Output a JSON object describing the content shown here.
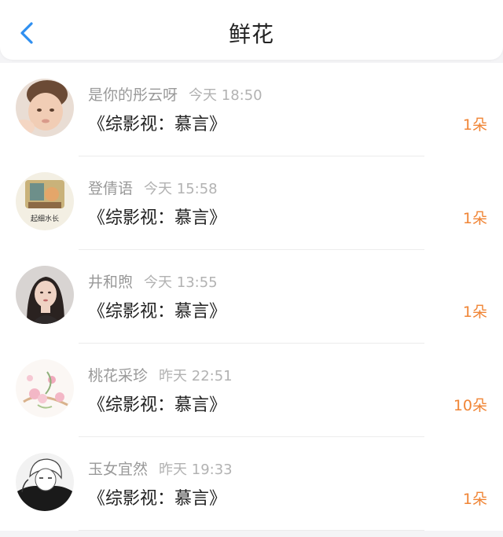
{
  "header": {
    "title": "鲜花",
    "back_icon": "chevron-left-icon",
    "accent": "#2f8ff0"
  },
  "colors": {
    "count": "#f08536",
    "name": "#999999",
    "book": "#222222"
  },
  "gifts": [
    {
      "user": "是你的彤云呀",
      "time": "今天 18:50",
      "book": "《综影视：慕言》",
      "count": "1朵",
      "avatar": "baby-photo-avatar"
    },
    {
      "user": "登倩语",
      "time": "今天 15:58",
      "book": "《综影视：慕言》",
      "count": "1朵",
      "avatar": "illustration-avatar",
      "avatar_text": "起细水长"
    },
    {
      "user": "井和煦",
      "time": "今天 13:55",
      "book": "《综影视：慕言》",
      "count": "1朵",
      "avatar": "woman-portrait-avatar"
    },
    {
      "user": "桃花采珍",
      "time": "昨天 22:51",
      "book": "《综影视：慕言》",
      "count": "10朵",
      "avatar": "flower-painting-avatar"
    },
    {
      "user": "玉女宜然",
      "time": "昨天 19:33",
      "book": "《综影视：慕言》",
      "count": "1朵",
      "avatar": "anime-boy-avatar"
    }
  ]
}
